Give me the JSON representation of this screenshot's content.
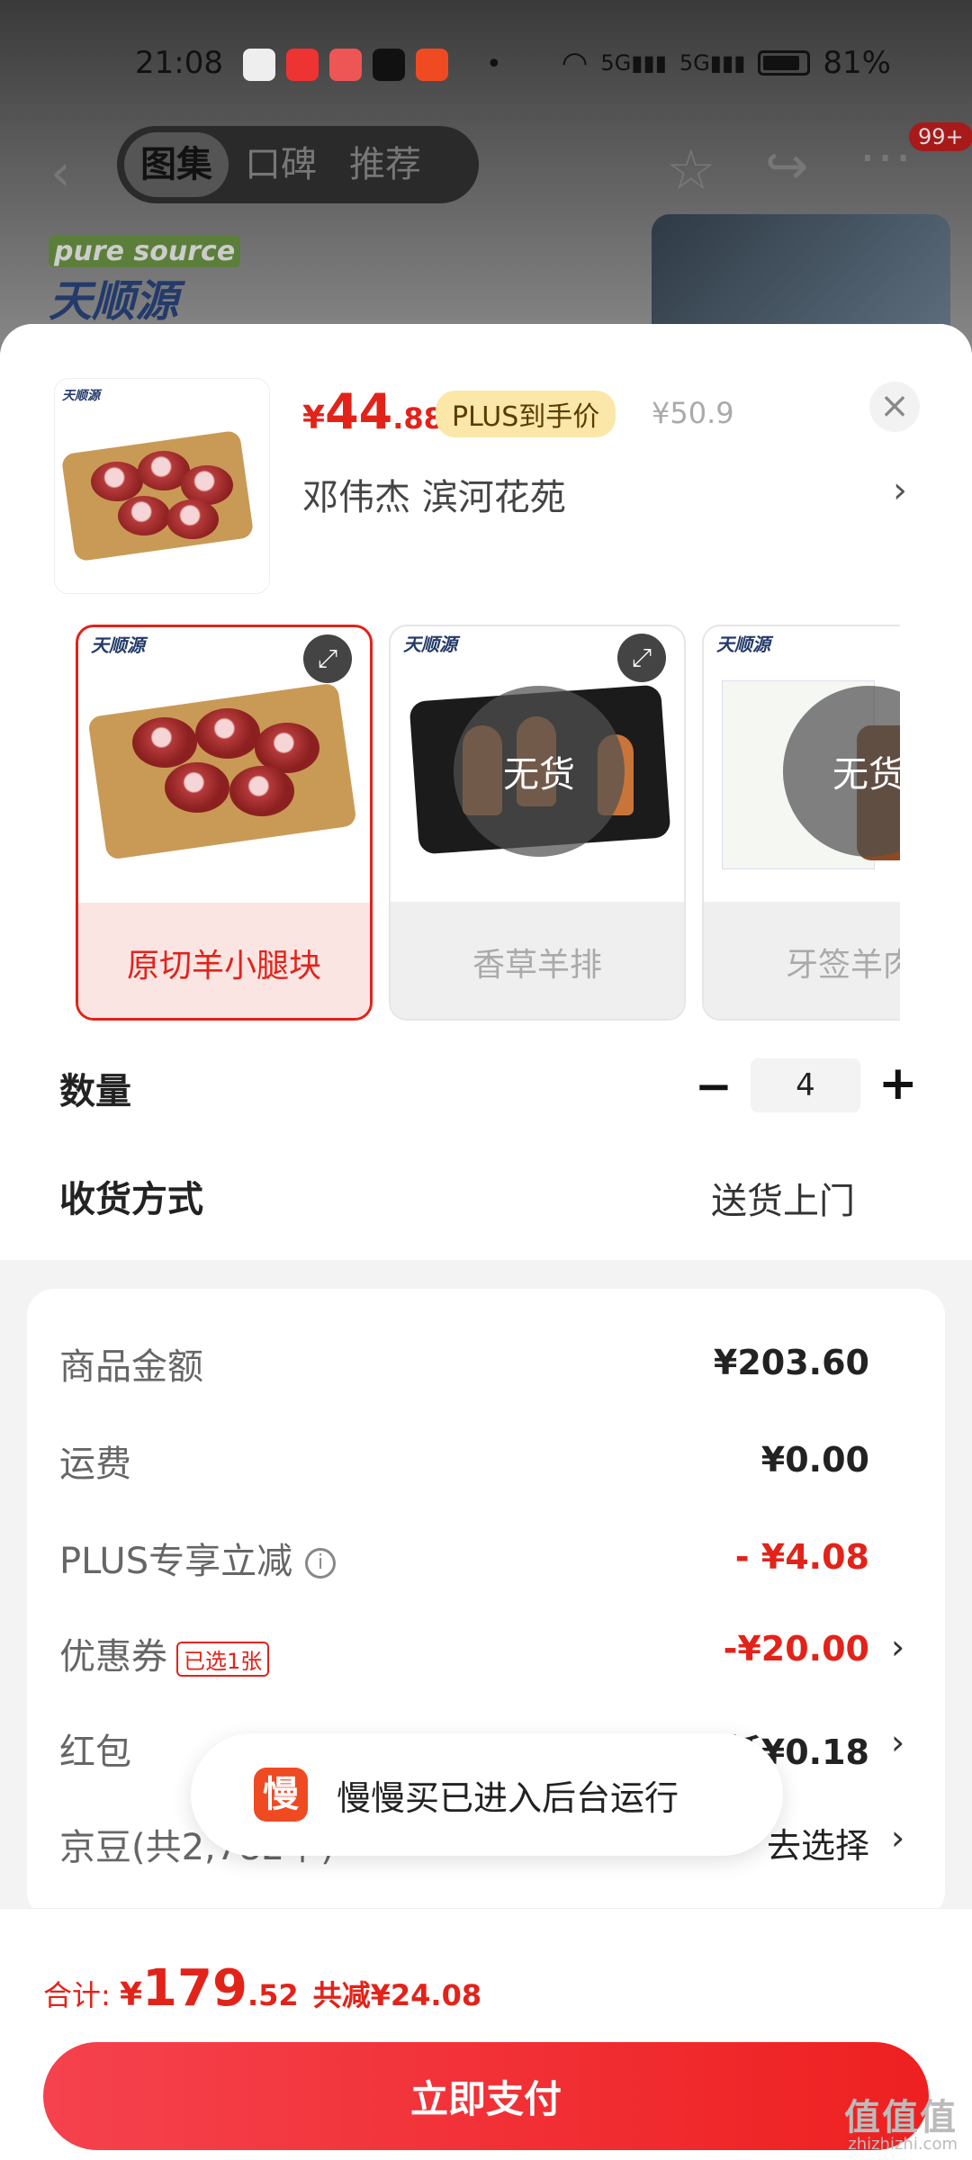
{
  "status_bar": {
    "time": "21:08",
    "battery": "81%"
  },
  "nav": {
    "tabs": [
      "图集",
      "口碑",
      "推荐"
    ],
    "active_tab": 0,
    "badge": "99+"
  },
  "product": {
    "price_symbol": "¥",
    "price_int": "44",
    "price_dec": ".88",
    "plus_tag": "PLUS到手价",
    "original_price": "¥50.9",
    "address": "邓伟杰  滨河花苑"
  },
  "variants": [
    {
      "label": "原切羊小腿块",
      "selected": true,
      "sold_out": false
    },
    {
      "label": "香草羊排",
      "selected": false,
      "sold_out": true,
      "status": "无货"
    },
    {
      "label": "牙签羊肉",
      "selected": false,
      "sold_out": true,
      "status": "无货"
    }
  ],
  "quantity": {
    "label": "数量",
    "value": "4",
    "minus": "−",
    "plus": "+"
  },
  "delivery": {
    "label": "收货方式",
    "value": "送货上门"
  },
  "summary": {
    "goods_label": "商品金额",
    "goods_value": "¥203.60",
    "shipping_label": "运费",
    "shipping_value": "¥0.00",
    "plus_label": "PLUS专享立减",
    "plus_value": "- ¥4.08",
    "coupon_label": "优惠券",
    "coupon_tag": "已选1张",
    "coupon_value": "-¥20.00",
    "redpacket_label": "红包",
    "redpacket_value": "最高可抵¥0.18",
    "jingdou_label": "京豆(共2,782个)",
    "jingdou_value": "去选择"
  },
  "toast": {
    "icon_char": "慢",
    "text": "慢慢买已进入后台运行"
  },
  "footer": {
    "total_label": "合计: ",
    "total_symbol": "¥",
    "total_int": "179",
    "total_dec": ".52",
    "saving": "共减¥24.08",
    "pay_button": "立即支付"
  },
  "watermark": {
    "text": "值值值",
    "sub": "zhizhizhi.com"
  },
  "colors": {
    "accent": "#e2231a",
    "plus_tag_bg": "#fbe7a8",
    "pay_button": "#f5424e"
  }
}
